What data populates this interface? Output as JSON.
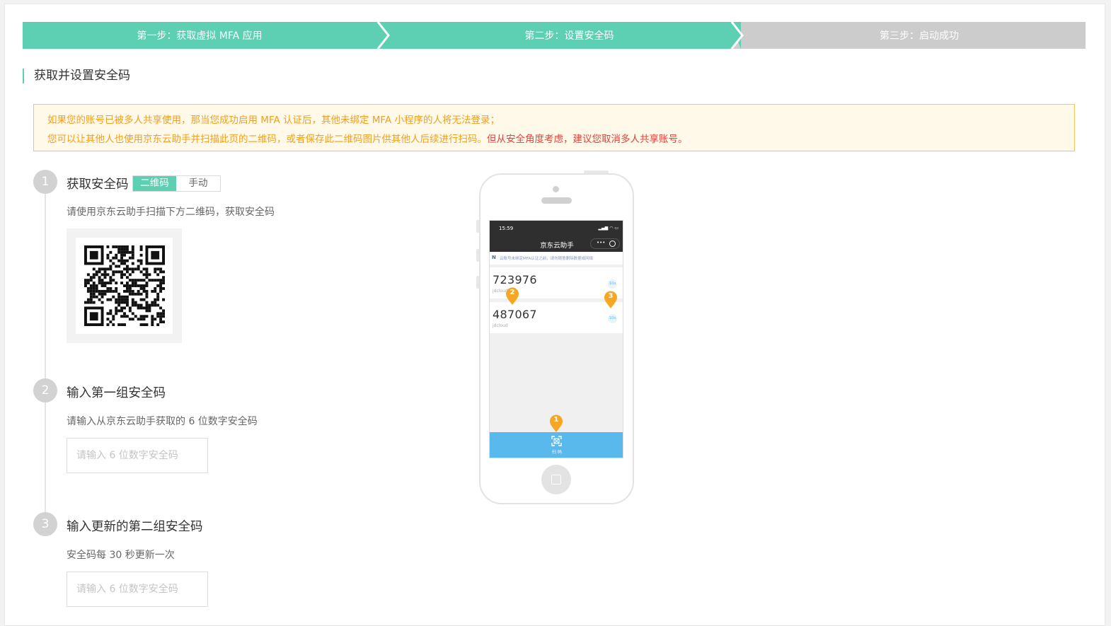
{
  "stepper": {
    "steps": [
      {
        "label": "第一步：获取虚拟 MFA 应用",
        "state": "done"
      },
      {
        "label": "第二步：设置安全码",
        "state": "active"
      },
      {
        "label": "第三步：启动成功",
        "state": "pending"
      }
    ]
  },
  "section_title": "获取并设置安全码",
  "notice": {
    "line1": "如果您的账号已被多人共享使用，那当您成功启用 MFA 认证后，其他未绑定 MFA 小程序的人将无法登录；",
    "line2": "您可以让其他人也使用京东云助手并扫描此页的二维码，或者保存此二维码图片供其他人后续进行扫码。",
    "line2_warning": "但从安全角度考虑，建议您取消多人共享账号。"
  },
  "steps": [
    {
      "number": "1",
      "title": "获取安全码",
      "tabs": [
        "二维码",
        "手动"
      ],
      "active_tab": "二维码",
      "description": "请使用京东云助手扫描下方二维码，获取安全码"
    },
    {
      "number": "2",
      "title": "输入第一组安全码",
      "description": "请输入从京东云助手获取的 6 位数字安全码",
      "placeholder": "请输入 6 位数字安全码"
    },
    {
      "number": "3",
      "title": "输入更新的第二组安全码",
      "description": "安全码每 30 秒更新一次",
      "placeholder": "请输入 6 位数字安全码"
    }
  ],
  "phone": {
    "time": "15:59",
    "app_title": "京东云助手",
    "capsule_dots": "•••",
    "tip": "云账号未绑定MFA认证之前，请勿随意删除数据或网络",
    "tip_icon": "N",
    "codes": [
      {
        "code": "723976",
        "account": "jdcloud",
        "secs": "10s"
      },
      {
        "code": "487067",
        "account": "jdcloud",
        "secs": "10s"
      }
    ],
    "scan_label": "扫 码",
    "markers": [
      "1",
      "2",
      "3"
    ]
  },
  "colors": {
    "accent": "#5dcfb3",
    "pending": "#cccccc",
    "notice_text": "#f0a020",
    "notice_warning": "#e2413a",
    "scan_bar": "#59b8ec",
    "marker": "#f5a623"
  }
}
